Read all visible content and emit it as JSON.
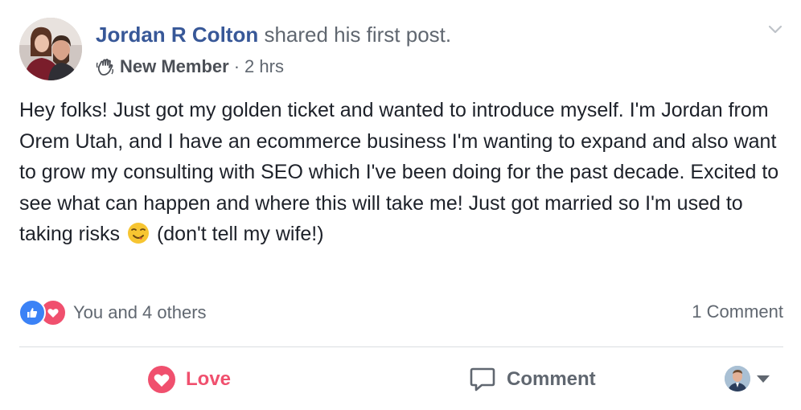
{
  "post": {
    "author": "Jordan R Colton",
    "action_text": "shared his first post.",
    "badge": "New Member",
    "badge_icon": "waving-hand-icon",
    "separator": "·",
    "timestamp": "2 hrs",
    "body_before_emoji": "Hey folks! Just got my golden ticket and wanted to introduce myself. I'm Jordan from Orem Utah, and I have an ecommerce business I'm wanting to expand and also want to grow my consulting with SEO which I've been doing for the past decade. Excited to see what can happen and where this will take me! Just got married so I'm used to taking risks",
    "emoji": "smirking-face-emoji",
    "body_after_emoji": "(don't tell my wife!)"
  },
  "reactions": {
    "icons": [
      "like-icon",
      "love-icon"
    ],
    "summary": "You and 4 others"
  },
  "comments": {
    "count_label": "1 Comment"
  },
  "actions": {
    "love_label": "Love",
    "comment_label": "Comment"
  },
  "colors": {
    "author": "#385898",
    "secondary_text": "#606770",
    "love": "#f0506e",
    "like": "#3b82f6",
    "divider": "#dadde1"
  }
}
